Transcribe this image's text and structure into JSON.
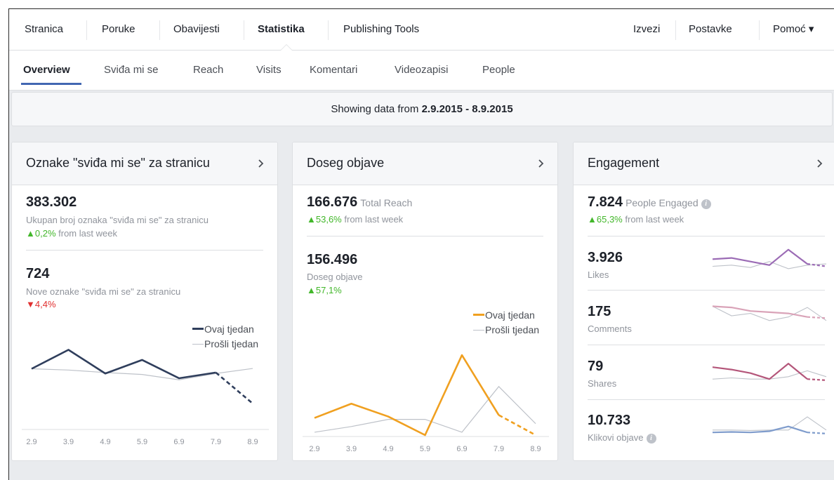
{
  "topnav": {
    "items": [
      "Stranica",
      "Poruke",
      "Obavijesti",
      "Statistika",
      "Publishing Tools"
    ],
    "right_items": [
      "Izvezi",
      "Postavke",
      "Pomoć ▾"
    ]
  },
  "subnav": {
    "items": [
      "Overview",
      "Sviđa mi se",
      "Reach",
      "Visits",
      "Komentari",
      "Videozapisi",
      "People"
    ]
  },
  "datebar": {
    "prefix": "Showing data from",
    "range": "2.9.2015 - 8.9.2015"
  },
  "likes_card": {
    "title": "Oznake \"sviđa mi se\" za stranicu",
    "total_value": "383.302",
    "total_desc": "Ukupan broj oznaka \"sviđa mi se\" za stranicu",
    "total_change": "0,2%",
    "total_change_rest": "from last week",
    "new_value": "724",
    "new_desc": "Nove oznake \"sviđa mi se\" za stranicu",
    "new_change": "4,4%",
    "legend_this": "Ovaj tjedan",
    "legend_last": "Prošli tjedan"
  },
  "reach_card": {
    "title": "Doseg objave",
    "total_value": "166.676",
    "total_label": "Total Reach",
    "total_change": "53,6%",
    "total_change_rest": "from last week",
    "post_value": "156.496",
    "post_desc": "Doseg objave",
    "post_change": "57,1%",
    "legend_this": "Ovaj tjedan",
    "legend_last": "Prošli tjedan"
  },
  "engagement_card": {
    "title": "Engagement",
    "total_value": "7.824",
    "total_label": "People Engaged",
    "total_change": "65,3%",
    "total_change_rest": "from last week",
    "rows": [
      {
        "value": "3.926",
        "label": "Likes"
      },
      {
        "value": "175",
        "label": "Comments"
      },
      {
        "value": "79",
        "label": "Shares"
      },
      {
        "value": "10.733",
        "label": "Klikovi objave"
      }
    ]
  },
  "icons": {
    "chevron": "chevron-right-icon",
    "up": "triangle-up-icon",
    "down": "triangle-down-icon",
    "info": "info-icon"
  },
  "colors": {
    "accent": "#4267b2",
    "likes_line": "#2f3e5c",
    "reach_line": "#f0a020",
    "up": "#42b72a",
    "down": "#e02f2f",
    "eng_likes": "#9b6bb5",
    "eng_comments": "#d9a3b8",
    "eng_shares": "#b4567a",
    "eng_clicks": "#7f9ccc"
  },
  "chart_data": [
    {
      "type": "line",
      "categories": [
        "2.9",
        "3.9",
        "4.9",
        "5.9",
        "6.9",
        "7.9",
        "8.9"
      ],
      "series": [
        {
          "name": "Ovaj tjedan",
          "values": [
            730,
            790,
            715,
            758,
            700,
            718,
            620
          ]
        },
        {
          "name": "Prošli tjedan",
          "values": [
            730,
            726,
            718,
            712,
            695,
            715,
            731
          ]
        }
      ]
    },
    {
      "type": "line",
      "categories": [
        "2.9",
        "3.9",
        "4.9",
        "5.9",
        "6.9",
        "7.9",
        "8.9"
      ],
      "series": [
        {
          "name": "Ovaj tjedan",
          "values": [
            12000,
            22000,
            13000,
            0,
            56000,
            14000,
            0
          ]
        },
        {
          "name": "Prošli tjedan",
          "values": [
            2000,
            6000,
            11000,
            11000,
            2000,
            34000,
            8000
          ]
        }
      ]
    },
    {
      "type": "line",
      "series": [
        {
          "values": [
            0.55,
            0.6,
            0.45,
            0.3,
            0.95,
            0.35,
            0.25
          ]
        },
        {
          "values": [
            0.25,
            0.3,
            0.2,
            0.45,
            0.15,
            0.3,
            0.35
          ]
        }
      ]
    },
    {
      "type": "line",
      "series": [
        {
          "values": [
            0.9,
            0.85,
            0.7,
            0.65,
            0.6,
            0.45,
            0.4
          ]
        },
        {
          "values": [
            0.9,
            0.5,
            0.6,
            0.3,
            0.45,
            0.85,
            0.3
          ]
        }
      ]
    },
    {
      "type": "line",
      "series": [
        {
          "values": [
            0.7,
            0.6,
            0.45,
            0.2,
            0.85,
            0.2,
            0.15
          ]
        },
        {
          "values": [
            0.2,
            0.25,
            0.2,
            0.2,
            0.3,
            0.55,
            0.3
          ]
        }
      ]
    },
    {
      "type": "line",
      "series": [
        {
          "values": [
            0.2,
            0.22,
            0.2,
            0.25,
            0.45,
            0.2,
            0.15
          ]
        },
        {
          "values": [
            0.3,
            0.3,
            0.28,
            0.3,
            0.3,
            0.85,
            0.3
          ]
        }
      ]
    }
  ]
}
